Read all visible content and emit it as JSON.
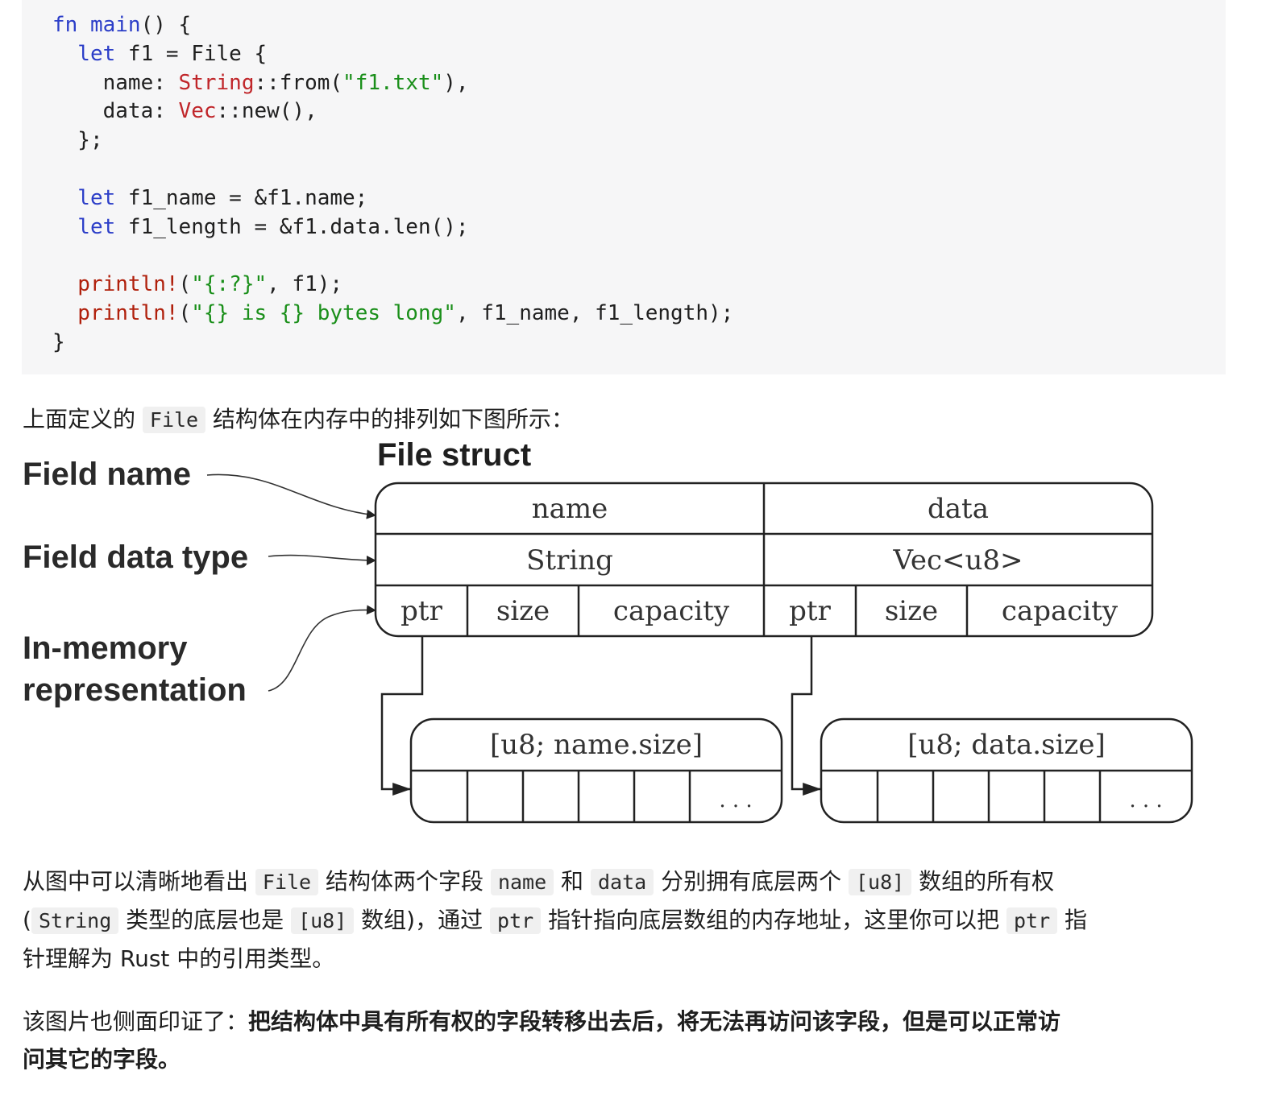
{
  "code": {
    "lines": [
      [
        {
          "t": "fn ",
          "c": "kw"
        },
        {
          "t": "main",
          "c": "fnname"
        },
        {
          "t": "() {",
          "c": ""
        }
      ],
      [
        {
          "t": "  let ",
          "c": "kw"
        },
        {
          "t": "f1 = File {",
          "c": ""
        }
      ],
      [
        {
          "t": "    name: ",
          "c": ""
        },
        {
          "t": "String",
          "c": "ty"
        },
        {
          "t": "::from(",
          "c": ""
        },
        {
          "t": "\"f1.txt\"",
          "c": "str"
        },
        {
          "t": "),",
          "c": ""
        }
      ],
      [
        {
          "t": "    data: ",
          "c": ""
        },
        {
          "t": "Vec",
          "c": "ty"
        },
        {
          "t": "::new(),",
          "c": ""
        }
      ],
      [
        {
          "t": "  };",
          "c": ""
        }
      ],
      [],
      [
        {
          "t": "  let ",
          "c": "kw"
        },
        {
          "t": "f1_name = &f1.name;",
          "c": ""
        }
      ],
      [
        {
          "t": "  let ",
          "c": "kw"
        },
        {
          "t": "f1_length = &f1.data.len();",
          "c": ""
        }
      ],
      [],
      [
        {
          "t": "  println!",
          "c": "mac"
        },
        {
          "t": "(",
          "c": ""
        },
        {
          "t": "\"{:?}\"",
          "c": "str"
        },
        {
          "t": ", f1);",
          "c": ""
        }
      ],
      [
        {
          "t": "  println!",
          "c": "mac"
        },
        {
          "t": "(",
          "c": ""
        },
        {
          "t": "\"{} is {} bytes long\"",
          "c": "str"
        },
        {
          "t": ", f1_name, f1_length);",
          "c": ""
        }
      ],
      [
        {
          "t": "}",
          "c": ""
        }
      ]
    ]
  },
  "intro": {
    "before": "上面定义的 ",
    "code": "File",
    "after": " 结构体在内存中的排列如下图所示："
  },
  "diagram": {
    "title": "File struct",
    "labels": {
      "field_name": "Field name",
      "field_type": "Field data type",
      "in_memory_1": "In-memory",
      "in_memory_2": "representation"
    },
    "fields": [
      "name",
      "data"
    ],
    "types": [
      "String",
      "Vec<u8>"
    ],
    "cells": [
      "ptr",
      "size",
      "capacity",
      "ptr",
      "size",
      "capacity"
    ],
    "arrays": [
      "[u8; name.size]",
      "[u8; data.size]"
    ],
    "ellipsis": ". . ."
  },
  "para1": {
    "s1": "从图中可以清晰地看出 ",
    "c1": "File",
    "s2": " 结构体两个字段 ",
    "c2": "name",
    "s3": " 和 ",
    "c3": "data",
    "s4": " 分别拥有底层两个 ",
    "c4": "[u8]",
    "s5": " 数组的所有权",
    "s6": "(",
    "c5": "String",
    "s7": " 类型的底层也是 ",
    "c6": "[u8]",
    "s8": " 数组)，通过 ",
    "c7": "ptr",
    "s9": " 指针指向底层数组的内存地址，这里你可以把 ",
    "c8": "ptr",
    "s10": " 指",
    "s11": "针理解为 Rust 中的引用类型。"
  },
  "para2": {
    "normal": "该图片也侧面印证了：",
    "bold_1": "把结构体中具有所有权的字段转移出去后，将无法再访问该字段，但是可以正常访",
    "bold_2": "问其它的字段。"
  }
}
